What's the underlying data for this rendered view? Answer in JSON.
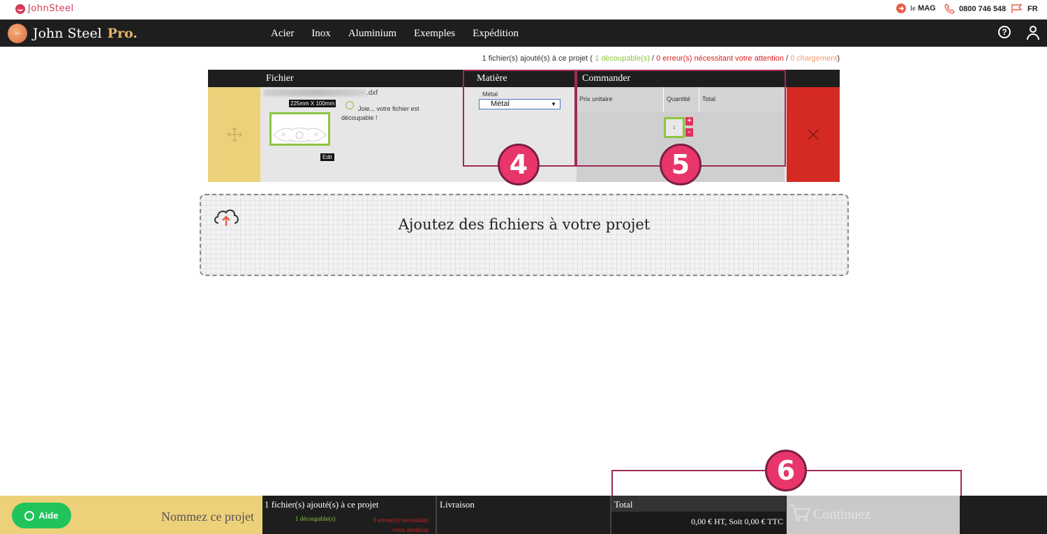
{
  "topbar": {
    "brand": "JohnSteel",
    "mag_prefix": "le",
    "mag": "MAG",
    "phone": "0800 746 548",
    "lang": "FR"
  },
  "nav": {
    "logo_name": "John Steel",
    "logo_pro": "Pro.",
    "items": [
      "Acier",
      "Inox",
      "Aluminium",
      "Exemples",
      "Expédition"
    ],
    "help": "?"
  },
  "summary": {
    "added": "1 fichier(s) ajouté(s) à ce projet (",
    "decoupable": "1 découpable(s)",
    "sep1": " / ",
    "errors": "0 erreur(s) nécessitant votre attention",
    "sep2": " / ",
    "loading": "0 chargement",
    "close": ")"
  },
  "table": {
    "headers": {
      "fichier": "Fichier",
      "matiere": "Matière",
      "commander": "Commander"
    },
    "file": {
      "ext": ".dxf",
      "dims": "225mm X 100mm",
      "edit": "Edit",
      "status": "Joie... votre fichier est découpable !"
    },
    "material": {
      "label": "Métal",
      "selected": "Métal"
    },
    "order": {
      "prix_unitaire": "Prix unitaire",
      "quantite": "Quantité",
      "total": "Total",
      "qty_value": "1",
      "plus": "+",
      "minus": "-"
    }
  },
  "annotations": [
    "4",
    "5",
    "6"
  ],
  "upload": {
    "label": "Ajoutez des fichiers à votre projet"
  },
  "footer": {
    "aide": "Aide",
    "project_name_placeholder": "Nommez ce projet",
    "files_header": "1 fichier(s) ajouté(s) à ce projet",
    "files_decoupable": "1 découpable(s)",
    "files_errors": "0 erreur(s) nécessitant votre attention",
    "livraison": "Livraison",
    "total_header": "Total",
    "total_value": "0,00 € HT, Soit 0,00 € TTC",
    "continue": "Continuez"
  },
  "colors": {
    "accent_pink": "#e8356a",
    "frame": "#9e2a5a",
    "ok_green": "#8cc63f",
    "error_red": "#e02020",
    "loading_orange": "#f29a6a",
    "move_yellow": "#edd07a",
    "delete_red": "#d52a24",
    "aide_green": "#20c45a"
  }
}
